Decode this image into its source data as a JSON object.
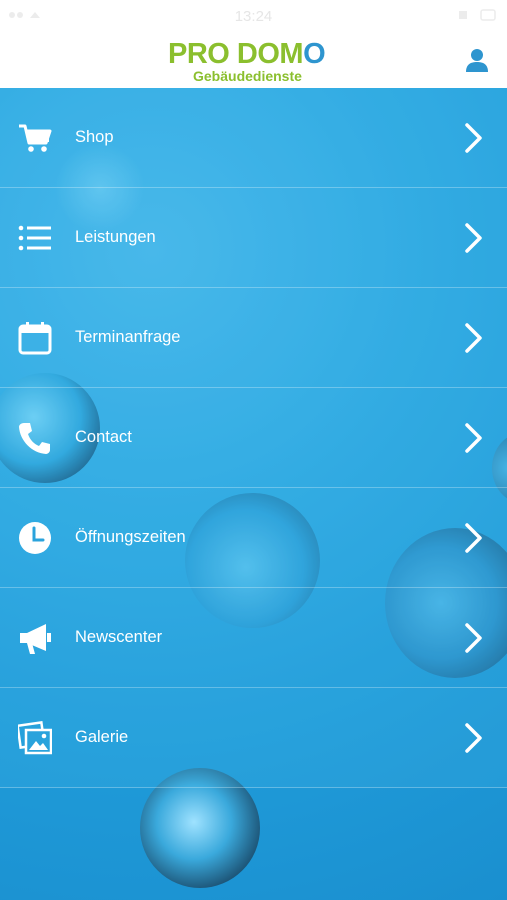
{
  "status": {
    "time": "13:24"
  },
  "header": {
    "brand_part1": "PRO DOM",
    "brand_part2": "O",
    "subtitle": "Gebäudedienste",
    "user_icon": "user-icon"
  },
  "menu": {
    "items": [
      {
        "label": "Shop",
        "icon": "cart-icon"
      },
      {
        "label": "Leistungen",
        "icon": "list-icon"
      },
      {
        "label": "Terminanfrage",
        "icon": "calendar-icon"
      },
      {
        "label": "Contact",
        "icon": "phone-icon"
      },
      {
        "label": "Öffnungszeiten",
        "icon": "clock-icon"
      },
      {
        "label": "Newscenter",
        "icon": "megaphone-icon"
      },
      {
        "label": "Galerie",
        "icon": "gallery-icon"
      }
    ]
  },
  "colors": {
    "brand_green": "#8bbf2e",
    "brand_blue": "#2e95cf",
    "background": "#29a6e0"
  }
}
